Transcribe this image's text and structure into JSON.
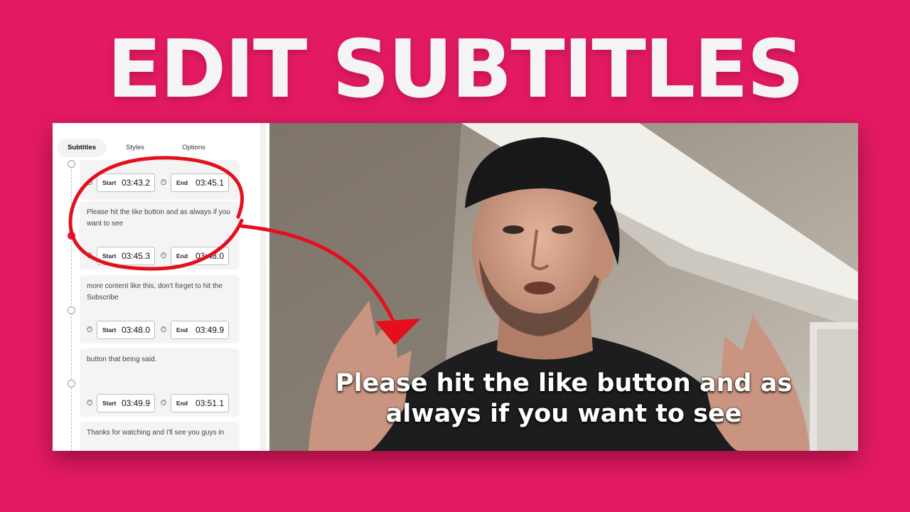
{
  "headline": "EDIT SUBTITLES",
  "tabs": [
    {
      "label": "Subtitles"
    },
    {
      "label": "Styles"
    },
    {
      "label": "Options"
    }
  ],
  "labels": {
    "start": "Start",
    "end": "End"
  },
  "cards": [
    {
      "text": "",
      "start": "03:43.2",
      "end": "03:45.1"
    },
    {
      "text": "Please hit the like button and as always if you want to see",
      "start": "03:45.3",
      "end": "03:48.0"
    },
    {
      "text": "more content like this, don't forget to hit the Subscribe",
      "start": "03:48.0",
      "end": "03:49.9"
    },
    {
      "text": "button that being said.",
      "start": "03:49.9",
      "end": "03:51.1"
    },
    {
      "text": "Thanks for watching and I'll see you guys in"
    }
  ],
  "video": {
    "subtitle_line1": "Please hit the like button and as",
    "subtitle_line2": "always if you want to see"
  },
  "icons": {
    "stopwatch": "stopwatch-icon"
  },
  "colors": {
    "background": "#e31a63",
    "annotation": "#e3101c",
    "headline": "#f4f4f4"
  }
}
